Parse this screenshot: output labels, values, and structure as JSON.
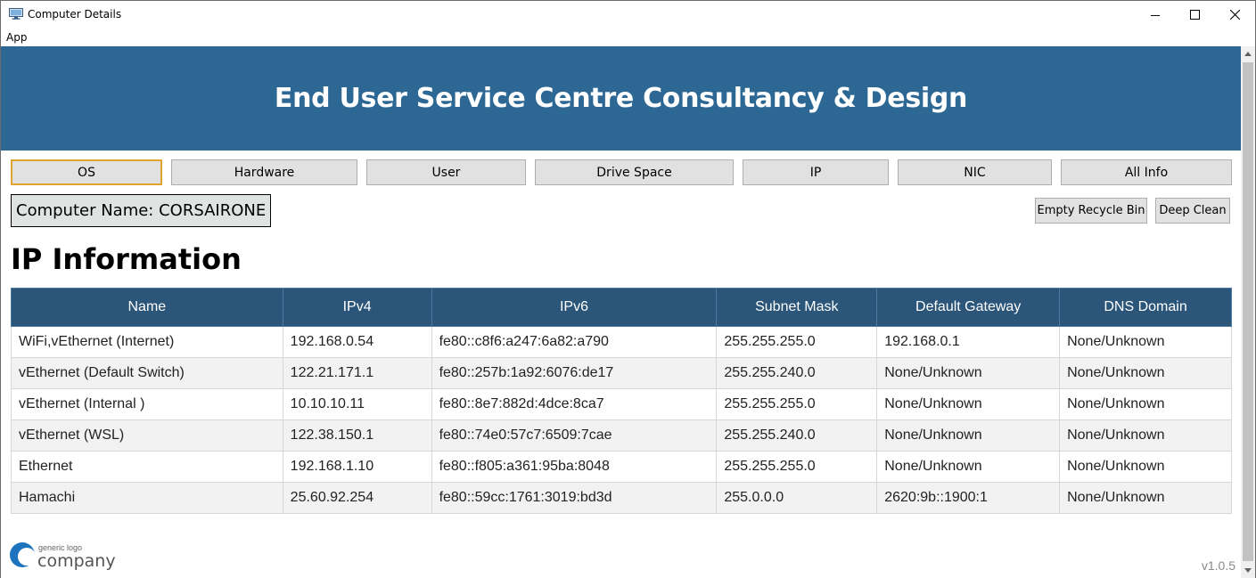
{
  "window": {
    "title": "Computer Details",
    "minimize_glyph": "—",
    "maximize_glyph": "☐",
    "close_glyph": "✕"
  },
  "menu": {
    "items": [
      {
        "label": "App"
      }
    ]
  },
  "banner": {
    "title": "End User Service Centre Consultancy & Design",
    "color": "#2d6895"
  },
  "nav": {
    "buttons": [
      {
        "label": "OS",
        "active": true
      },
      {
        "label": "Hardware"
      },
      {
        "label": "User"
      },
      {
        "label": "Drive Space"
      },
      {
        "label": "IP"
      },
      {
        "label": "NIC"
      },
      {
        "label": "All Info"
      }
    ]
  },
  "computer_name": "Computer Name: CORSAIRONE",
  "actions": {
    "empty_recycle_bin": "Empty Recycle Bin",
    "deep_clean": "Deep Clean"
  },
  "section_title": "IP Information",
  "table": {
    "headers": [
      "Name",
      "IPv4",
      "IPv6",
      "Subnet Mask",
      "Default Gateway",
      "DNS Domain"
    ],
    "rows": [
      [
        "WiFi,vEthernet (Internet)",
        "192.168.0.54",
        "fe80::c8f6:a247:6a82:a790",
        "255.255.255.0",
        "192.168.0.1",
        "None/Unknown"
      ],
      [
        "vEthernet (Default Switch)",
        "122.21.171.1",
        "fe80::257b:1a92:6076:de17",
        "255.255.240.0",
        "None/Unknown",
        "None/Unknown"
      ],
      [
        "vEthernet (Internal )",
        "10.10.10.11",
        "fe80::8e7:882d:4dce:8ca7",
        "255.255.255.0",
        "None/Unknown",
        "None/Unknown"
      ],
      [
        "vEthernet (WSL)",
        "122.38.150.1",
        "fe80::74e0:57c7:6509:7cae",
        "255.255.240.0",
        "None/Unknown",
        "None/Unknown"
      ],
      [
        "Ethernet",
        "192.168.1.10",
        "fe80::f805:a361:95ba:8048",
        "255.255.255.0",
        "None/Unknown",
        "None/Unknown"
      ],
      [
        "Hamachi",
        "25.60.92.254",
        "fe80::59cc:1761:3019:bd3d",
        "255.0.0.0",
        "2620:9b::1900:1",
        "None/Unknown"
      ]
    ],
    "header_color": "#2b5579"
  },
  "logo": {
    "small_text": "generic logo",
    "large_text": "company",
    "color": "#1e73be"
  },
  "version": "v1.0.5"
}
